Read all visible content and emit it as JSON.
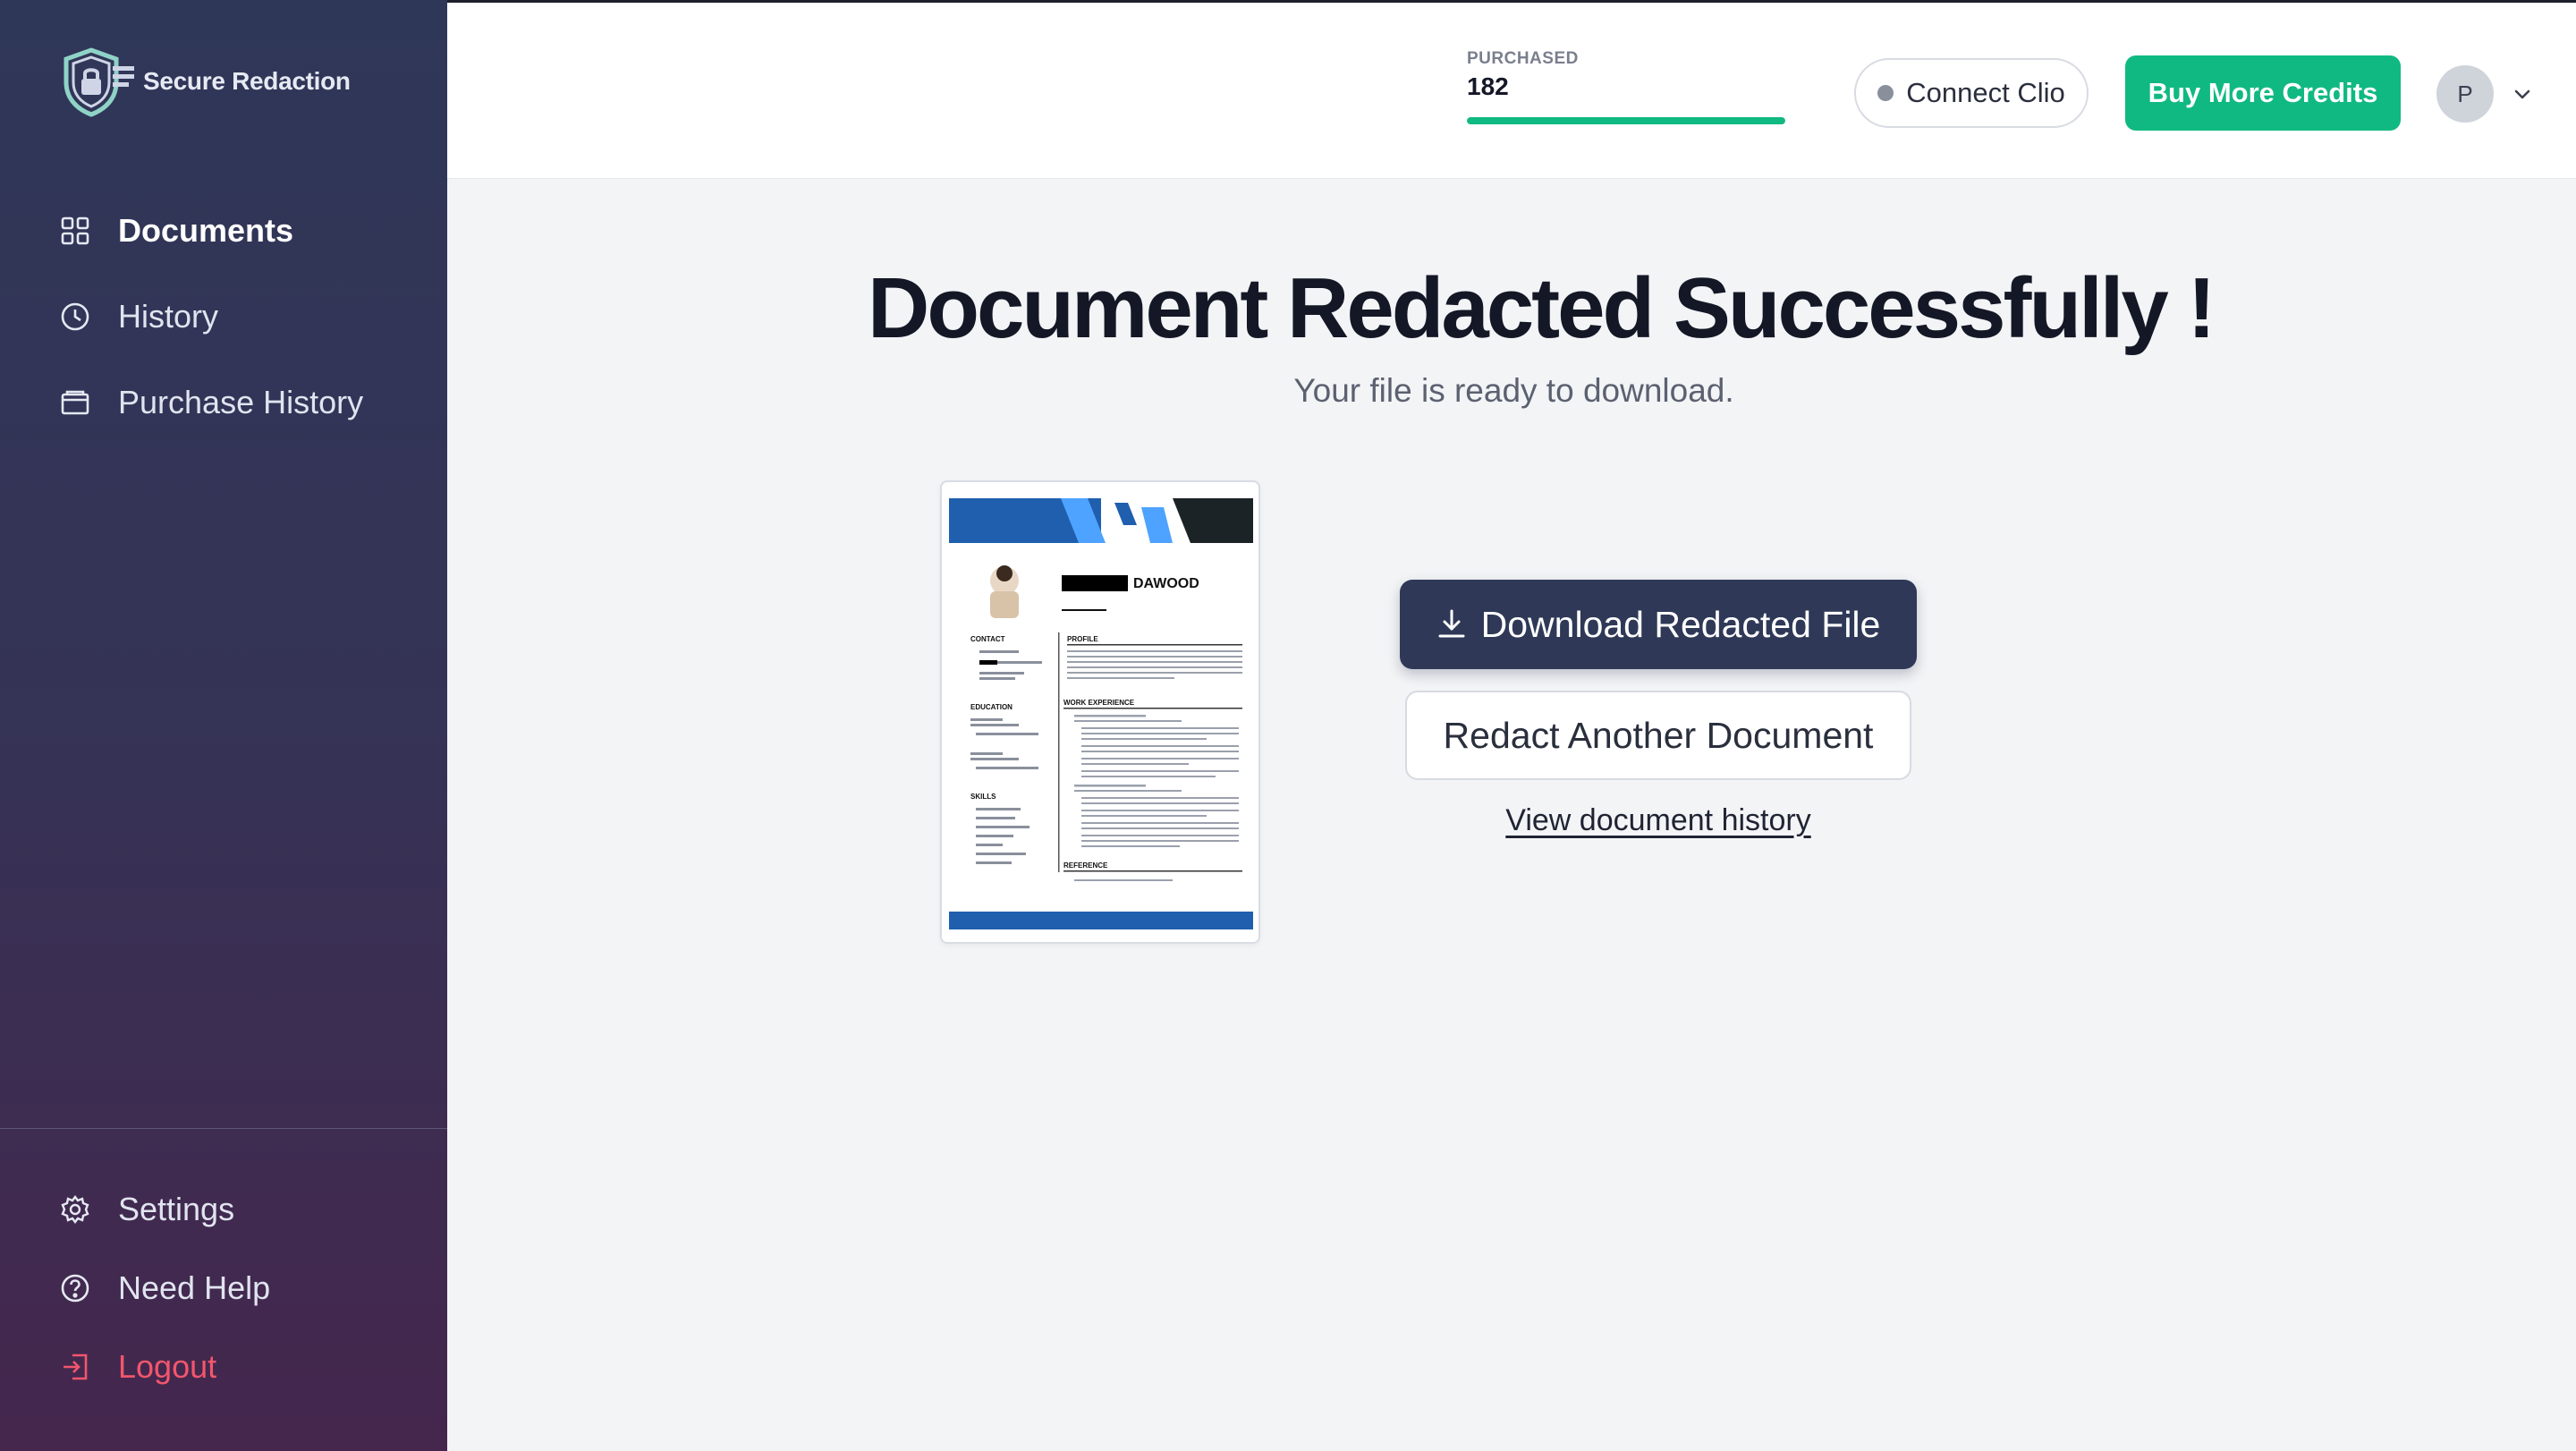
{
  "brand": {
    "name": "Secure Redaction",
    "icon": "shield-lock-icon"
  },
  "sidebar": {
    "items": [
      {
        "label": "Documents",
        "icon": "grid-icon",
        "active": true
      },
      {
        "label": "History",
        "icon": "clock-icon",
        "active": false
      },
      {
        "label": "Purchase History",
        "icon": "wallet-icon",
        "active": false
      }
    ],
    "bottom": [
      {
        "label": "Settings",
        "icon": "gear-icon"
      },
      {
        "label": "Need Help",
        "icon": "help-circle-icon"
      },
      {
        "label": "Logout",
        "icon": "logout-icon"
      }
    ]
  },
  "header": {
    "credits_caption": "PURCHASED",
    "credits_value": "182",
    "credits_progress": 1.0,
    "connect_label": "Connect Clio",
    "buy_label": "Buy More Credits",
    "avatar_initial": "P"
  },
  "main": {
    "title": "Document Redacted Successfully !",
    "subtitle": "Your file is ready to download.",
    "preview_name": "DAWOOD",
    "download_label": "Download Redacted File",
    "redact_again_label": "Redact Another Document",
    "history_link_label": "View document history"
  },
  "colors": {
    "sidebar_top": "#2f3758",
    "sidebar_bottom": "#45264d",
    "accent_green": "#10b981",
    "primary_dark": "#2f3957",
    "logout_red": "#f2566c"
  }
}
